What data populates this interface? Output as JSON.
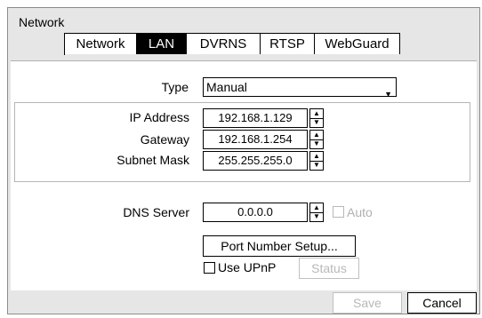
{
  "dialog": {
    "title": "Network",
    "tabs": [
      {
        "label": "Network",
        "active": false
      },
      {
        "label": "LAN",
        "active": true
      },
      {
        "label": "DVRNS",
        "active": false
      },
      {
        "label": "RTSP",
        "active": false
      },
      {
        "label": "WebGuard",
        "active": false
      }
    ]
  },
  "lan": {
    "type_label": "Type",
    "type_value": "Manual",
    "ip_label": "IP Address",
    "ip_value": "192.168.1.129",
    "gateway_label": "Gateway",
    "gateway_value": "192.168.1.254",
    "subnet_label": "Subnet Mask",
    "subnet_value": "255.255.255.0",
    "dns_label": "DNS Server",
    "dns_value": "0.0.0.0",
    "auto_label": "Auto",
    "auto_checked": false,
    "port_setup_label": "Port Number Setup...",
    "upnp_label": "Use UPnP",
    "upnp_checked": false,
    "status_label": "Status"
  },
  "footer": {
    "save_label": "Save",
    "cancel_label": "Cancel"
  }
}
